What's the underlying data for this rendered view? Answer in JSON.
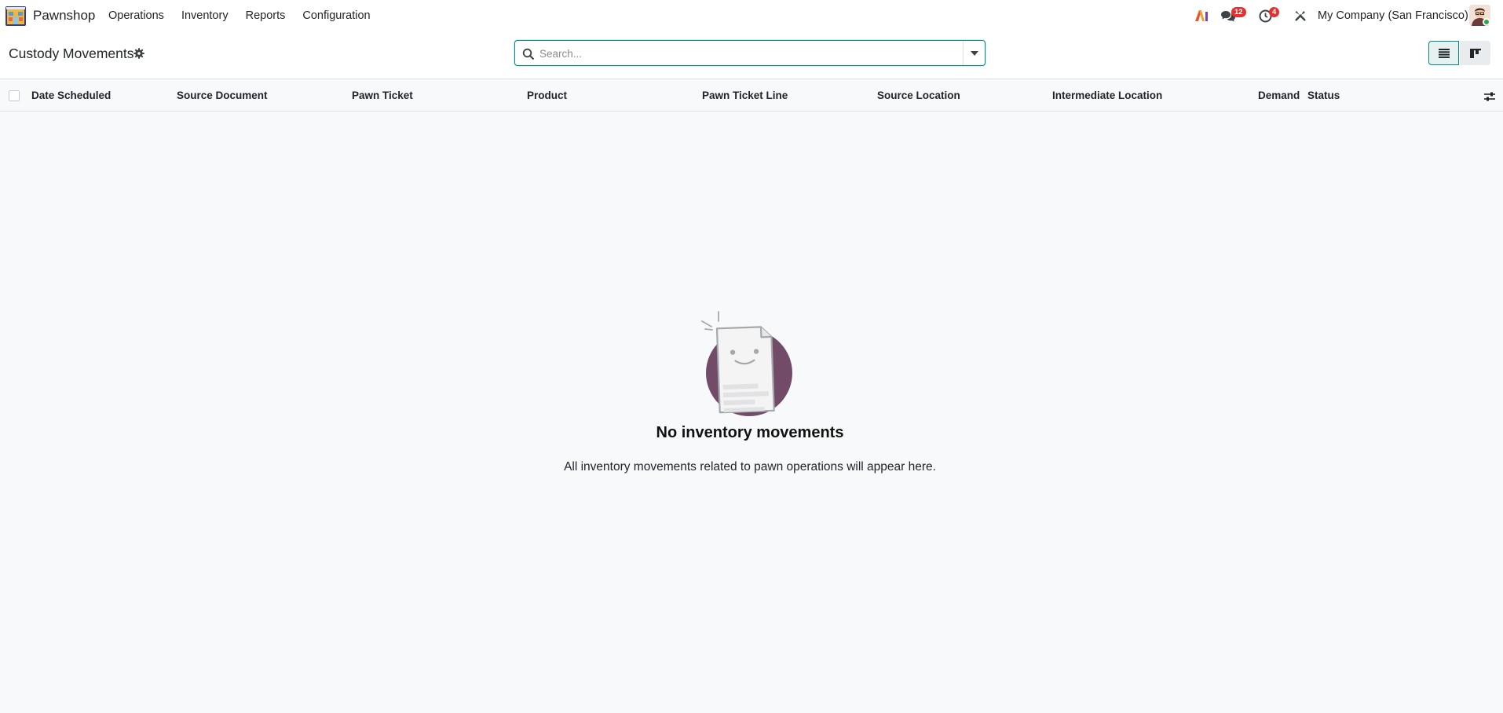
{
  "app": {
    "name": "Pawnshop",
    "menu": [
      "Operations",
      "Inventory",
      "Reports",
      "Configuration"
    ]
  },
  "systray": {
    "ai_label": "AI",
    "messages_count": "12",
    "activities_count": "4",
    "company": "My Company (San Francisco)"
  },
  "control_panel": {
    "title": "Custody Movements",
    "search_placeholder": "Search...",
    "active_view": "list"
  },
  "table": {
    "columns": [
      "Date Scheduled",
      "Source Document",
      "Pawn Ticket",
      "Product",
      "Pawn Ticket Line",
      "Source Location",
      "Intermediate Location",
      "Demand",
      "Status"
    ]
  },
  "empty_state": {
    "title": "No inventory movements",
    "description": "All inventory movements related to pawn operations will appear here."
  },
  "colors": {
    "accent": "#018c8a",
    "brand_purple": "#714b67",
    "badge_red": "#e0302f"
  }
}
